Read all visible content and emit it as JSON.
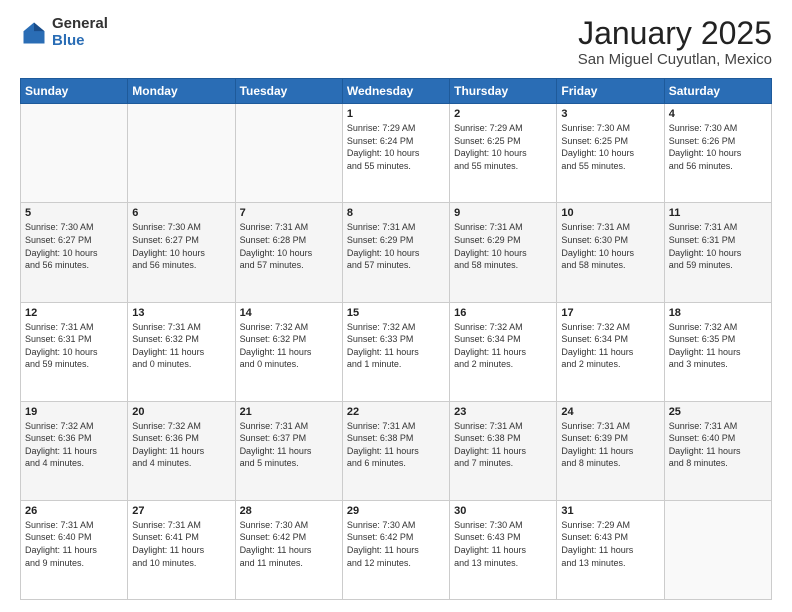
{
  "header": {
    "logo": {
      "general": "General",
      "blue": "Blue"
    },
    "title": "January 2025",
    "location": "San Miguel Cuyutlan, Mexico"
  },
  "days_of_week": [
    "Sunday",
    "Monday",
    "Tuesday",
    "Wednesday",
    "Thursday",
    "Friday",
    "Saturday"
  ],
  "weeks": [
    [
      {
        "day": "",
        "info": ""
      },
      {
        "day": "",
        "info": ""
      },
      {
        "day": "",
        "info": ""
      },
      {
        "day": "1",
        "info": "Sunrise: 7:29 AM\nSunset: 6:24 PM\nDaylight: 10 hours\nand 55 minutes."
      },
      {
        "day": "2",
        "info": "Sunrise: 7:29 AM\nSunset: 6:25 PM\nDaylight: 10 hours\nand 55 minutes."
      },
      {
        "day": "3",
        "info": "Sunrise: 7:30 AM\nSunset: 6:25 PM\nDaylight: 10 hours\nand 55 minutes."
      },
      {
        "day": "4",
        "info": "Sunrise: 7:30 AM\nSunset: 6:26 PM\nDaylight: 10 hours\nand 56 minutes."
      }
    ],
    [
      {
        "day": "5",
        "info": "Sunrise: 7:30 AM\nSunset: 6:27 PM\nDaylight: 10 hours\nand 56 minutes."
      },
      {
        "day": "6",
        "info": "Sunrise: 7:30 AM\nSunset: 6:27 PM\nDaylight: 10 hours\nand 56 minutes."
      },
      {
        "day": "7",
        "info": "Sunrise: 7:31 AM\nSunset: 6:28 PM\nDaylight: 10 hours\nand 57 minutes."
      },
      {
        "day": "8",
        "info": "Sunrise: 7:31 AM\nSunset: 6:29 PM\nDaylight: 10 hours\nand 57 minutes."
      },
      {
        "day": "9",
        "info": "Sunrise: 7:31 AM\nSunset: 6:29 PM\nDaylight: 10 hours\nand 58 minutes."
      },
      {
        "day": "10",
        "info": "Sunrise: 7:31 AM\nSunset: 6:30 PM\nDaylight: 10 hours\nand 58 minutes."
      },
      {
        "day": "11",
        "info": "Sunrise: 7:31 AM\nSunset: 6:31 PM\nDaylight: 10 hours\nand 59 minutes."
      }
    ],
    [
      {
        "day": "12",
        "info": "Sunrise: 7:31 AM\nSunset: 6:31 PM\nDaylight: 10 hours\nand 59 minutes."
      },
      {
        "day": "13",
        "info": "Sunrise: 7:31 AM\nSunset: 6:32 PM\nDaylight: 11 hours\nand 0 minutes."
      },
      {
        "day": "14",
        "info": "Sunrise: 7:32 AM\nSunset: 6:32 PM\nDaylight: 11 hours\nand 0 minutes."
      },
      {
        "day": "15",
        "info": "Sunrise: 7:32 AM\nSunset: 6:33 PM\nDaylight: 11 hours\nand 1 minute."
      },
      {
        "day": "16",
        "info": "Sunrise: 7:32 AM\nSunset: 6:34 PM\nDaylight: 11 hours\nand 2 minutes."
      },
      {
        "day": "17",
        "info": "Sunrise: 7:32 AM\nSunset: 6:34 PM\nDaylight: 11 hours\nand 2 minutes."
      },
      {
        "day": "18",
        "info": "Sunrise: 7:32 AM\nSunset: 6:35 PM\nDaylight: 11 hours\nand 3 minutes."
      }
    ],
    [
      {
        "day": "19",
        "info": "Sunrise: 7:32 AM\nSunset: 6:36 PM\nDaylight: 11 hours\nand 4 minutes."
      },
      {
        "day": "20",
        "info": "Sunrise: 7:32 AM\nSunset: 6:36 PM\nDaylight: 11 hours\nand 4 minutes."
      },
      {
        "day": "21",
        "info": "Sunrise: 7:31 AM\nSunset: 6:37 PM\nDaylight: 11 hours\nand 5 minutes."
      },
      {
        "day": "22",
        "info": "Sunrise: 7:31 AM\nSunset: 6:38 PM\nDaylight: 11 hours\nand 6 minutes."
      },
      {
        "day": "23",
        "info": "Sunrise: 7:31 AM\nSunset: 6:38 PM\nDaylight: 11 hours\nand 7 minutes."
      },
      {
        "day": "24",
        "info": "Sunrise: 7:31 AM\nSunset: 6:39 PM\nDaylight: 11 hours\nand 8 minutes."
      },
      {
        "day": "25",
        "info": "Sunrise: 7:31 AM\nSunset: 6:40 PM\nDaylight: 11 hours\nand 8 minutes."
      }
    ],
    [
      {
        "day": "26",
        "info": "Sunrise: 7:31 AM\nSunset: 6:40 PM\nDaylight: 11 hours\nand 9 minutes."
      },
      {
        "day": "27",
        "info": "Sunrise: 7:31 AM\nSunset: 6:41 PM\nDaylight: 11 hours\nand 10 minutes."
      },
      {
        "day": "28",
        "info": "Sunrise: 7:30 AM\nSunset: 6:42 PM\nDaylight: 11 hours\nand 11 minutes."
      },
      {
        "day": "29",
        "info": "Sunrise: 7:30 AM\nSunset: 6:42 PM\nDaylight: 11 hours\nand 12 minutes."
      },
      {
        "day": "30",
        "info": "Sunrise: 7:30 AM\nSunset: 6:43 PM\nDaylight: 11 hours\nand 13 minutes."
      },
      {
        "day": "31",
        "info": "Sunrise: 7:29 AM\nSunset: 6:43 PM\nDaylight: 11 hours\nand 13 minutes."
      },
      {
        "day": "",
        "info": ""
      }
    ]
  ]
}
